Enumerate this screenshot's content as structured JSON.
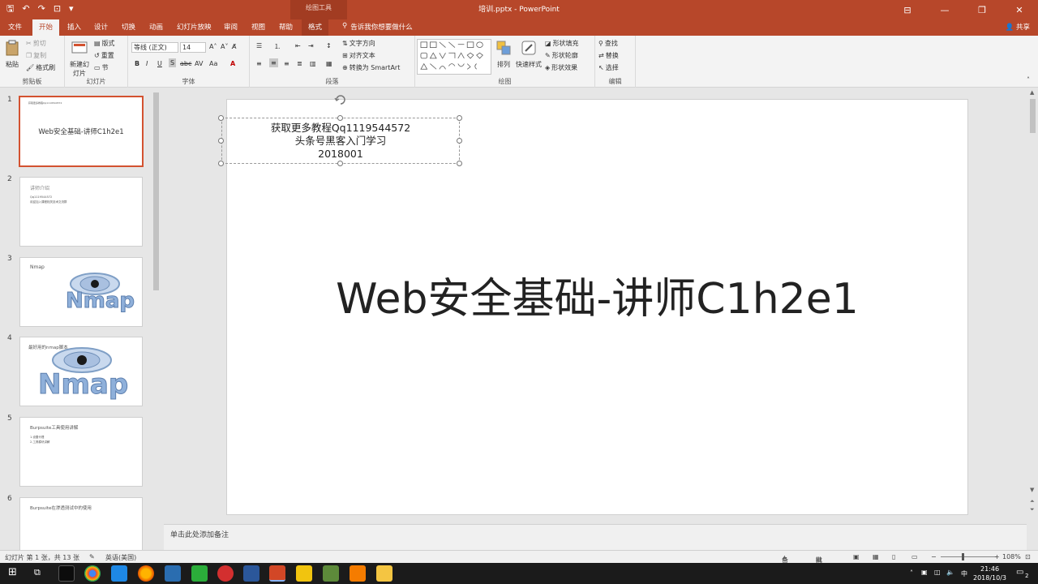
{
  "window": {
    "doc_title": "培训.pptx  -  PowerPoint",
    "context_title": "绘图工具",
    "share": "共享",
    "controls": [
      "—",
      "❐",
      "✕"
    ]
  },
  "tabs": [
    {
      "label": "文件"
    },
    {
      "label": "开始",
      "active": true
    },
    {
      "label": "插入"
    },
    {
      "label": "设计"
    },
    {
      "label": "切换"
    },
    {
      "label": "动画"
    },
    {
      "label": "幻灯片放映"
    },
    {
      "label": "审阅"
    },
    {
      "label": "视图"
    },
    {
      "label": "帮助"
    },
    {
      "label": "格式",
      "context": true
    }
  ],
  "tellme": "告诉我你想要做什么",
  "ribbon": {
    "clipboard": {
      "label": "剪贴板",
      "paste": "粘贴",
      "cut": "剪切",
      "copy": "复制",
      "format_painter": "格式刷"
    },
    "slides": {
      "label": "幻灯片",
      "new_slide": "新建幻灯片",
      "layout": "版式",
      "reset": "重置",
      "section": "节"
    },
    "font": {
      "label": "字体",
      "font_name": "等线 (正文)",
      "font_size": "14"
    },
    "paragraph": {
      "label": "段落",
      "text_direction": "文字方向",
      "align_text": "对齐文本",
      "smartart": "转换为 SmartArt"
    },
    "drawing": {
      "label": "绘图",
      "arrange": "排列",
      "quick_styles": "快速样式",
      "shape_fill": "形状填充",
      "shape_outline": "形状轮廓",
      "shape_effects": "形状效果"
    },
    "editing": {
      "label": "编辑",
      "find": "查找",
      "replace": "替换",
      "select": "选择"
    }
  },
  "thumbnails": [
    {
      "num": "1",
      "title": "Web安全基础-讲师C1h2e1",
      "small": "获取更多教程Qq1119544572",
      "selected": true
    },
    {
      "num": "2",
      "title": "讲师介绍",
      "bullets": [
        "Qq1119544572",
        "欢迎加入课程相关技术交流群"
      ]
    },
    {
      "num": "3",
      "title": "Nmap",
      "logo": "Nmap"
    },
    {
      "num": "4",
      "title": "最好用的nmap脚本",
      "logo": "Nmap"
    },
    {
      "num": "5",
      "title": "Burpsuite工具使用讲解",
      "bullets": [
        "1.设置代理",
        "2.工具模块讲解"
      ]
    },
    {
      "num": "6",
      "title": "Burpsuite在渗透测试中的使用"
    }
  ],
  "slide": {
    "subtitle_lines": [
      "获取更多教程Qq1119544572",
      "头条号黑客入门学习",
      "2018001"
    ],
    "title": "Web安全基础-讲师C1h2e1"
  },
  "notes_placeholder": "单击此处添加备注",
  "status": {
    "slide_info": "幻灯片 第 1 张，共 13 张",
    "language": "英语(美国)",
    "notes": "备注",
    "comments": "批注",
    "zoom": "108%"
  },
  "taskbar": {
    "time": "21:46",
    "date": "2018/10/3",
    "ime": "中",
    "notifications": "2"
  }
}
